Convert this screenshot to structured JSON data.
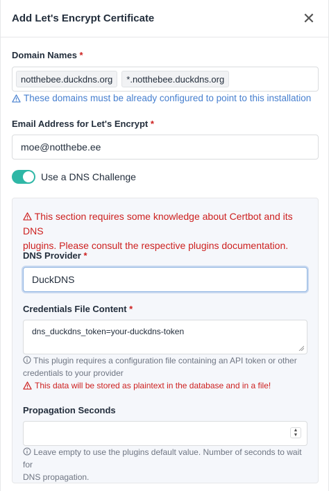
{
  "header": {
    "title": "Add Let's Encrypt Certificate",
    "close_glyph": "✕"
  },
  "domains": {
    "label": "Domain Names",
    "required_mark": "*",
    "tags": [
      "notthebee.duckdns.org",
      "*.notthebee.duckdns.org"
    ],
    "hint": "These domains must be already configured to point to this installation"
  },
  "email": {
    "label": "Email Address for Let's Encrypt",
    "required_mark": "*",
    "value": "moe@notthebe.ee"
  },
  "dns_challenge": {
    "label": "Use a DNS Challenge",
    "enabled": true
  },
  "dns_panel": {
    "warning_line1": "This section requires some knowledge about Certbot and its DNS",
    "warning_line2": "plugins. Please consult the respective plugins documentation.",
    "provider": {
      "label": "DNS Provider",
      "required_mark": "*",
      "value": "DuckDNS"
    },
    "credentials": {
      "label": "Credentials File Content",
      "required_mark": "*",
      "value": "dns_duckdns_token=your-duckdns-token",
      "info_line1": "This plugin requires a configuration file containing an API token or other",
      "info_line2": "credentials to your provider",
      "warning": "This data will be stored as plaintext in the database and in a file!"
    },
    "propagation": {
      "label": "Propagation Seconds",
      "value": "",
      "info_line1": "Leave empty to use the plugins default value. Number of seconds to wait for",
      "info_line2": "DNS propagation."
    }
  },
  "colors": {
    "accent": "#467fcf",
    "toggle": "#2fb7a6",
    "danger": "#cd201f"
  }
}
